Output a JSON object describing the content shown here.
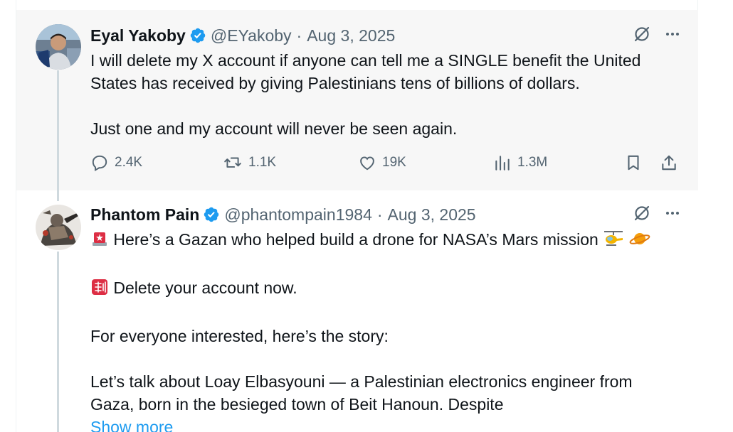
{
  "tweets": [
    {
      "author": "Eyal Yakoby",
      "handle": "@EYakoby",
      "separator": "·",
      "date": "Aug 3, 2025",
      "body": [
        "I will delete my X account if anyone can tell me a SINGLE benefit the United",
        "States has received by giving Palestinians tens of billions of dollars.",
        "",
        "Just one and my account will never be seen again."
      ],
      "actions": {
        "replies": "2.4K",
        "reposts": "1.1K",
        "likes": "19K",
        "views": "1.3M"
      }
    },
    {
      "author": "Phantom Pain",
      "handle": "@phantompain1984",
      "separator": "·",
      "date": "Aug 3, 2025",
      "line1": "Here’s a Gazan who helped build a drone for NASA’s Mars mission",
      "line2": "Delete your account now.",
      "line3": "For everyone interested, here’s the story:",
      "line4": "Let’s talk about Loay Elbasyouni — a Palestinian electronics engineer from",
      "line5": "Gaza, born in the besieged town of Beit Hanoun. Despite",
      "show_more": "Show more"
    }
  ],
  "colors": {
    "verified": "#1d9bf0",
    "link": "#1d9bf0",
    "secondary_text": "#536471",
    "primary_text": "#0f1419",
    "highlight_bg": "#f7f7f7"
  },
  "icons": [
    "verified-badge-icon",
    "grok-icon",
    "more-icon",
    "reply-icon",
    "repost-icon",
    "like-icon",
    "views-icon",
    "bookmark-icon",
    "share-icon",
    "siren-emoji",
    "helicopter-emoji",
    "planet-emoji",
    "cjk-discount-emoji"
  ]
}
